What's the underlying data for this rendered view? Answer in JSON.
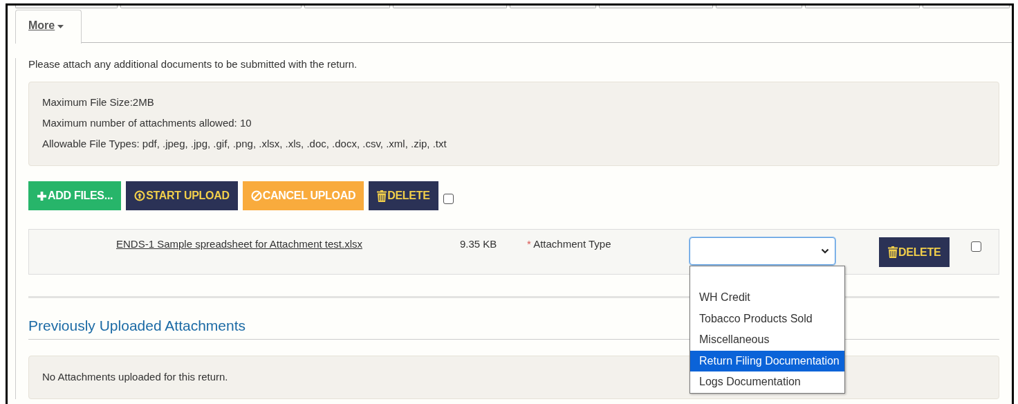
{
  "tabs": [
    {
      "label": "More",
      "selected": true
    }
  ],
  "intro": "Please attach any additional documents to be submitted with the return.",
  "limits": [
    "Maximum File Size:2MB",
    "Maximum number of attachments allowed: 10",
    "Allowable File Types: pdf, .jpeg, .jpg, .gif, .png, .xlsx, .xls, .doc, .docx, .csv, .xml, .zip, .txt"
  ],
  "toolbar": {
    "buttons": [
      {
        "kind": "add",
        "label": "ADD FILES..."
      },
      {
        "kind": "start",
        "label": "START UPLOAD"
      },
      {
        "kind": "cancel",
        "label": "CANCEL UPLOAD"
      },
      {
        "kind": "delete",
        "label": "DELETE"
      }
    ],
    "select_all_checked": false
  },
  "files": [
    {
      "name": "ENDS-1 Sample spreadsheet for Attachment test.xlsx",
      "size": "9.35 KB",
      "type_label": "Attachment Type",
      "required_mark": "*",
      "type_select": {
        "expanded": true,
        "options": [
          {
            "label": "WH Credit",
            "selected": false
          },
          {
            "label": "Tobacco Products Sold",
            "selected": false
          },
          {
            "label": "Miscellaneous",
            "selected": false
          },
          {
            "label": "Return Filing Documentation",
            "selected": true
          },
          {
            "label": "Logs Documentation",
            "selected": false
          }
        ]
      },
      "delete_button": "DELETE",
      "checked": false
    }
  ],
  "previous": {
    "heading": "Previously Uploaded Attachments",
    "message": "No Attachments uploaded for this return."
  }
}
